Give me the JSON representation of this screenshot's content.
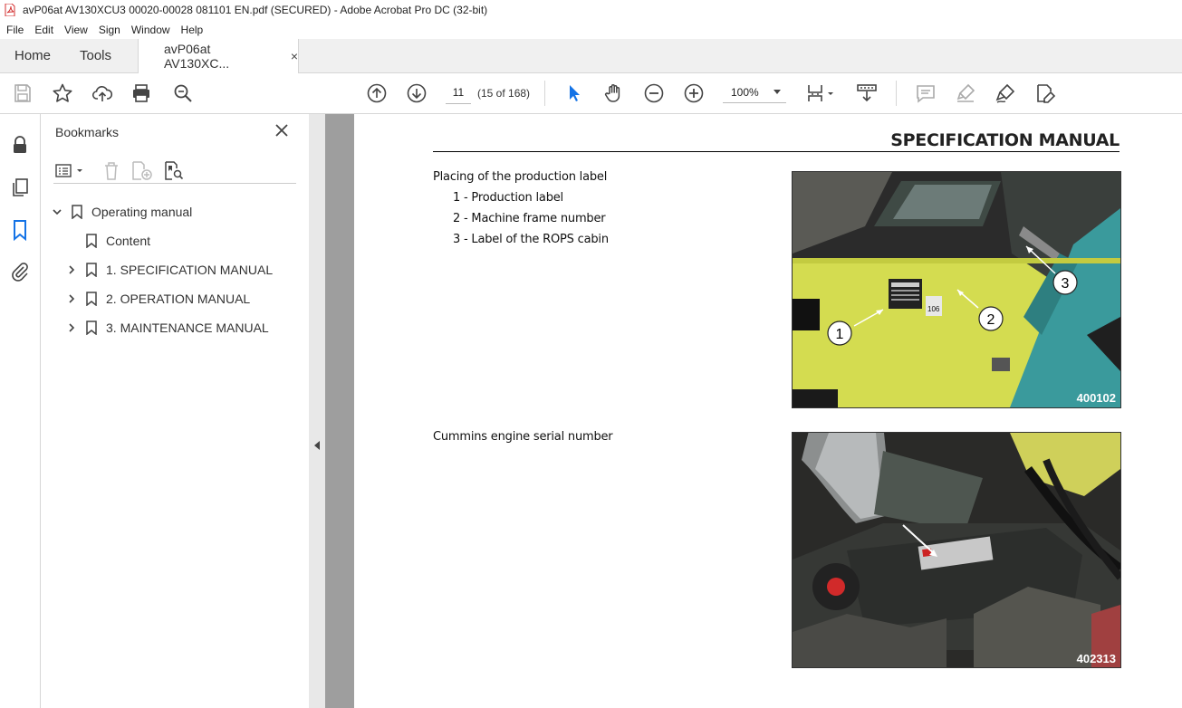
{
  "window": {
    "title": "avP06at AV130XCU3 00020-00028 081101 EN.pdf (SECURED) - Adobe Acrobat Pro DC (32-bit)"
  },
  "menu": [
    "File",
    "Edit",
    "View",
    "Sign",
    "Window",
    "Help"
  ],
  "tabs": {
    "home": "Home",
    "tools": "Tools",
    "document": "avP06at AV130XC...",
    "close": "×"
  },
  "toolbar": {
    "page_number": "11",
    "page_count": "(15 of 168)",
    "zoom": "100%"
  },
  "bookmarks": {
    "title": "Bookmarks",
    "items": [
      {
        "label": "Operating manual",
        "expanded": true
      },
      {
        "label": "Content"
      },
      {
        "label": "1. SPECIFICATION MANUAL"
      },
      {
        "label": "2. OPERATION MANUAL"
      },
      {
        "label": "3. MAINTENANCE MANUAL"
      }
    ]
  },
  "page": {
    "header": "SPECIFICATION MANUAL",
    "section1": {
      "heading": "Placing of the production label",
      "items": [
        "1 - Production label",
        "2 - Machine frame number",
        "3 - Label of the ROPS cabin"
      ],
      "figure_id": "400102",
      "callouts": [
        "1",
        "2",
        "3"
      ],
      "plate_text": "106"
    },
    "section2": {
      "heading": "Cummins engine serial number",
      "figure_id": "402313"
    }
  },
  "colors": {
    "accent_blue": "#1473e6",
    "machine_yellow": "#d4dc50",
    "cabin_teal": "#3a9a9c"
  }
}
